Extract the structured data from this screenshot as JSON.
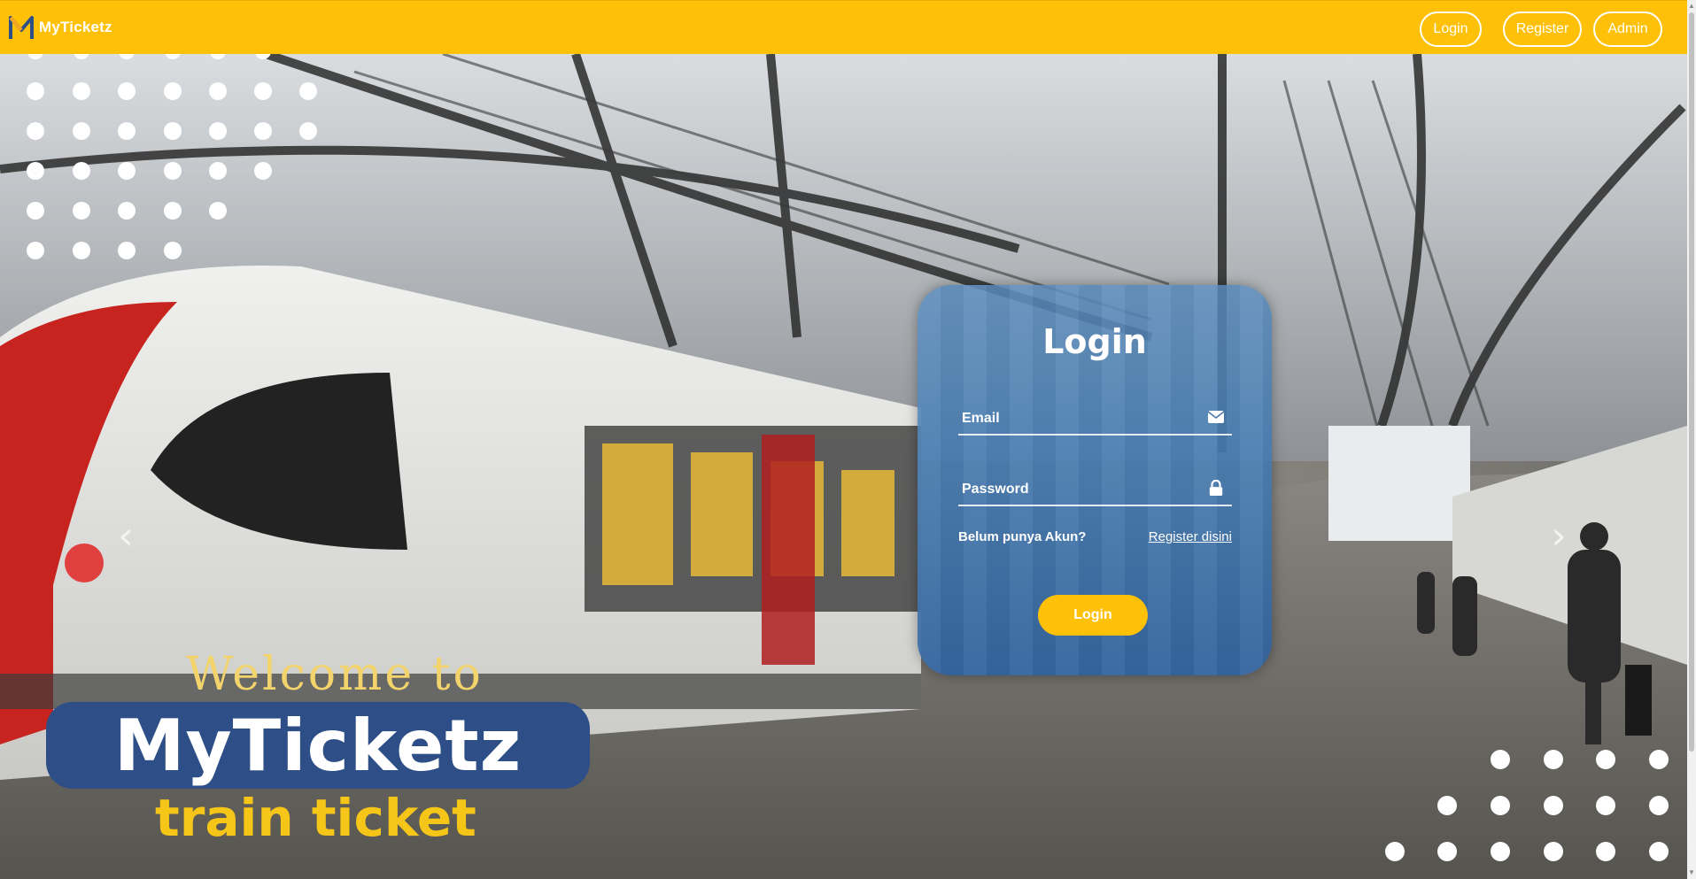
{
  "navbar": {
    "brand": "MyTicketz",
    "links": {
      "login": "Login",
      "register": "Register",
      "admin": "Admin"
    },
    "colors": {
      "background": "#ffc107",
      "text": "#ffffff"
    }
  },
  "hero": {
    "welcome": "Welcome to",
    "brand_title": "MyTicketz",
    "subtitle": "train ticket",
    "carousel": {
      "prev_icon": "chevron-left-icon",
      "next_icon": "chevron-right-icon"
    }
  },
  "login_form": {
    "title": "Login",
    "email": {
      "placeholder": "Email",
      "value": "",
      "icon": "envelope-icon"
    },
    "password": {
      "placeholder": "Password",
      "value": "",
      "icon": "lock-icon"
    },
    "no_account_text": "Belum punya Akun?",
    "register_link": "Register disini",
    "submit_label": "Login"
  }
}
